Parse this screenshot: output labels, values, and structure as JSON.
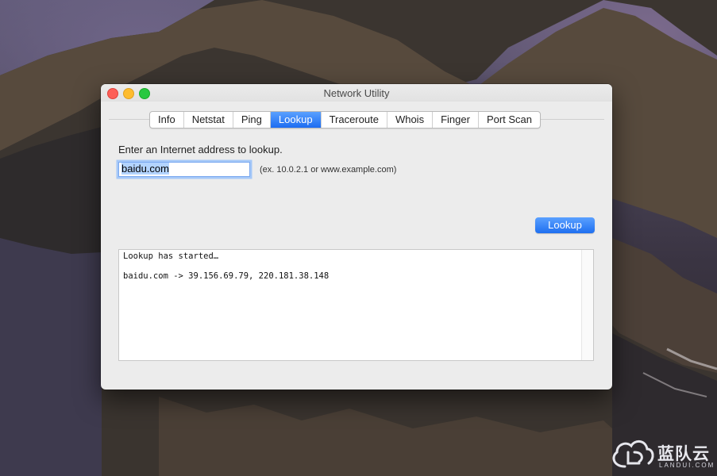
{
  "window": {
    "title": "Network Utility"
  },
  "tabs": [
    {
      "label": "Info",
      "selected": false
    },
    {
      "label": "Netstat",
      "selected": false
    },
    {
      "label": "Ping",
      "selected": false
    },
    {
      "label": "Lookup",
      "selected": true
    },
    {
      "label": "Traceroute",
      "selected": false
    },
    {
      "label": "Whois",
      "selected": false
    },
    {
      "label": "Finger",
      "selected": false
    },
    {
      "label": "Port Scan",
      "selected": false
    }
  ],
  "lookup": {
    "prompt": "Enter an Internet address to lookup.",
    "address_value": "baidu.com",
    "example_hint": "(ex. 10.0.2.1 or www.example.com)",
    "button_label": "Lookup"
  },
  "output": {
    "line1": "Lookup has started…",
    "line2": "baidu.com -> 39.156.69.79, 220.181.38.148"
  },
  "watermark": {
    "text": "蓝队云",
    "sub": "LANDUI.COM"
  },
  "colors": {
    "accent": "#1c6cf1",
    "close": "#fd5f57",
    "minimize": "#febc2e",
    "zoom": "#28c840"
  }
}
